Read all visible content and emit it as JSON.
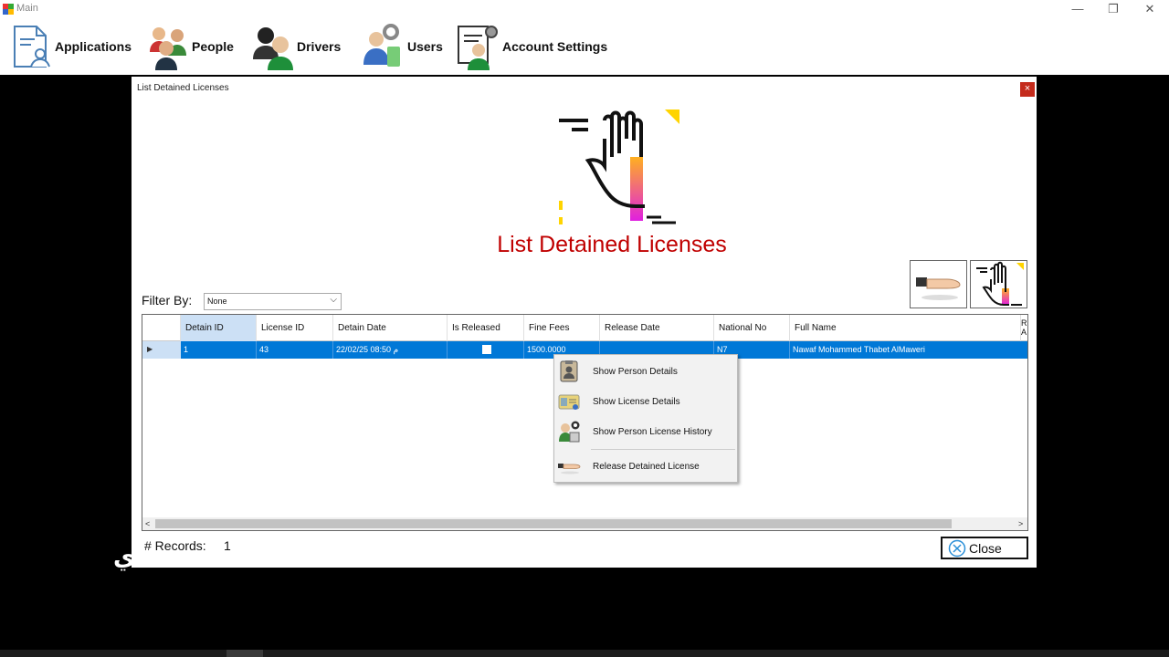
{
  "window": {
    "title": "Main",
    "minimize": "—",
    "restore": "❐",
    "close": "✕"
  },
  "menu": [
    {
      "label": "Applications",
      "icon": "applications-icon"
    },
    {
      "label": "People",
      "icon": "people-icon"
    },
    {
      "label": "Drivers",
      "icon": "drivers-icon"
    },
    {
      "label": "Users",
      "icon": "users-icon"
    },
    {
      "label": "Account Settings",
      "icon": "account-settings-icon"
    }
  ],
  "dialog": {
    "title": "List Detained Licenses",
    "close_glyph": "×",
    "heading": "List Detained Licenses",
    "filter": {
      "label": "Filter By:",
      "value": "None",
      "chevron": "⌵"
    },
    "grid": {
      "columns": [
        "Detain ID",
        "License ID",
        "Detain Date",
        "Is Released",
        "Fine Fees",
        "Release Date",
        "National No",
        "Full Name"
      ],
      "cut_column": "R\nA",
      "row_indicator": "▶",
      "rows": [
        {
          "detain_id": "1",
          "license_id": "43",
          "detain_date": "22/02/25 08:50 م",
          "is_released": false,
          "fine_fees": "1500.0000",
          "release_date": "",
          "national_no": "N7",
          "full_name": "Nawaf Mohammed Thabet AlMaweri"
        }
      ],
      "scroll_left": "<",
      "scroll_right": ">"
    },
    "records_label": "# Records:",
    "records_count": "1",
    "close_label": "Close"
  },
  "context_menu": [
    {
      "label": "Show Person Details",
      "icon": "person-card-icon"
    },
    {
      "label": "Show License Details",
      "icon": "license-card-icon"
    },
    {
      "label": "Show Person License History",
      "icon": "license-history-icon"
    },
    {
      "label": "Release Detained License",
      "icon": "release-hand-icon"
    }
  ],
  "background_text": "ي",
  "colors": {
    "accent": "#0078d7",
    "heading": "#c00000",
    "close_red": "#c42b1c",
    "selection_light": "#cce0f5"
  }
}
